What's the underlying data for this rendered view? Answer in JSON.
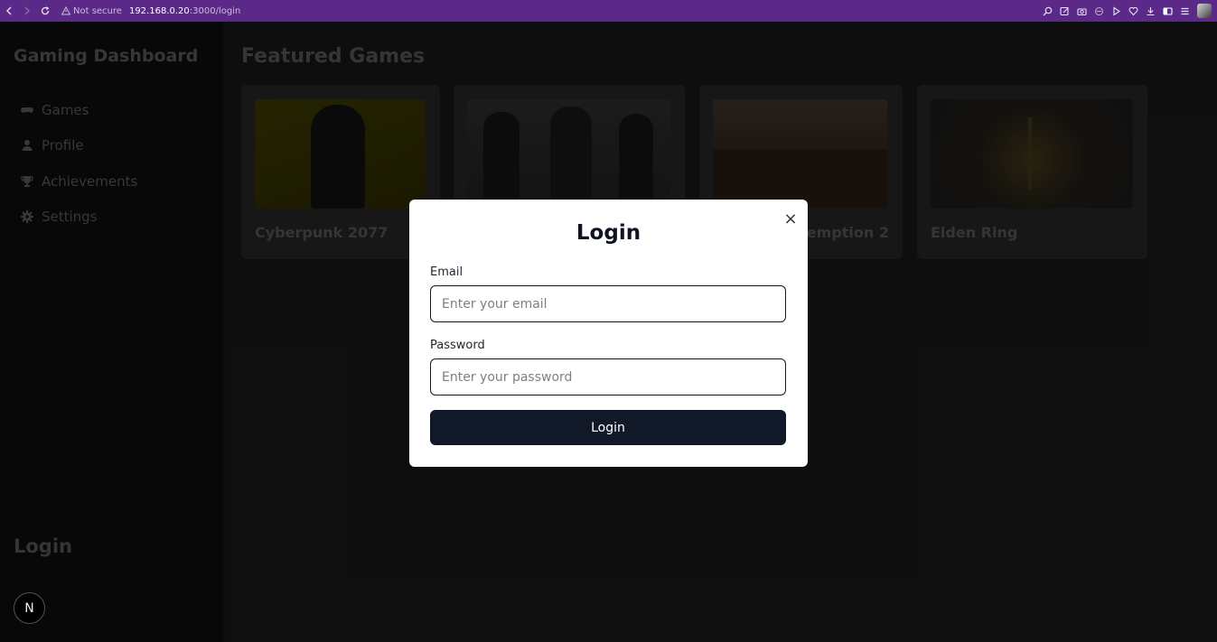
{
  "browser": {
    "security_label": "Not secure",
    "url_host": "192.168.0.20",
    "url_rest": ":3000/login"
  },
  "sidebar": {
    "brand": "Gaming Dashboard",
    "items": [
      {
        "label": "Games",
        "icon": "gamepad-icon"
      },
      {
        "label": "Profile",
        "icon": "user-icon"
      },
      {
        "label": "Achievements",
        "icon": "trophy-icon"
      },
      {
        "label": "Settings",
        "icon": "gear-icon"
      }
    ],
    "login_label": "Login",
    "badge": "N"
  },
  "main": {
    "title": "Featured Games",
    "games": [
      {
        "title": "Cyberpunk 2077",
        "accent": "#c9b800"
      },
      {
        "title": "",
        "accent": "#1c1c1c"
      },
      {
        "title": "Red Dead Redemption 2",
        "accent": "#3d2a20"
      },
      {
        "title": "Elden Ring",
        "accent": "#3a2c12"
      }
    ]
  },
  "modal": {
    "title": "Login",
    "close": "×",
    "email_label": "Email",
    "email_placeholder": "Enter your email",
    "password_label": "Password",
    "password_placeholder": "Enter your password",
    "submit_label": "Login"
  },
  "colors": {
    "browser_bar": "#5b2a88",
    "button": "#111827",
    "sidebar_bg": "#090909"
  }
}
